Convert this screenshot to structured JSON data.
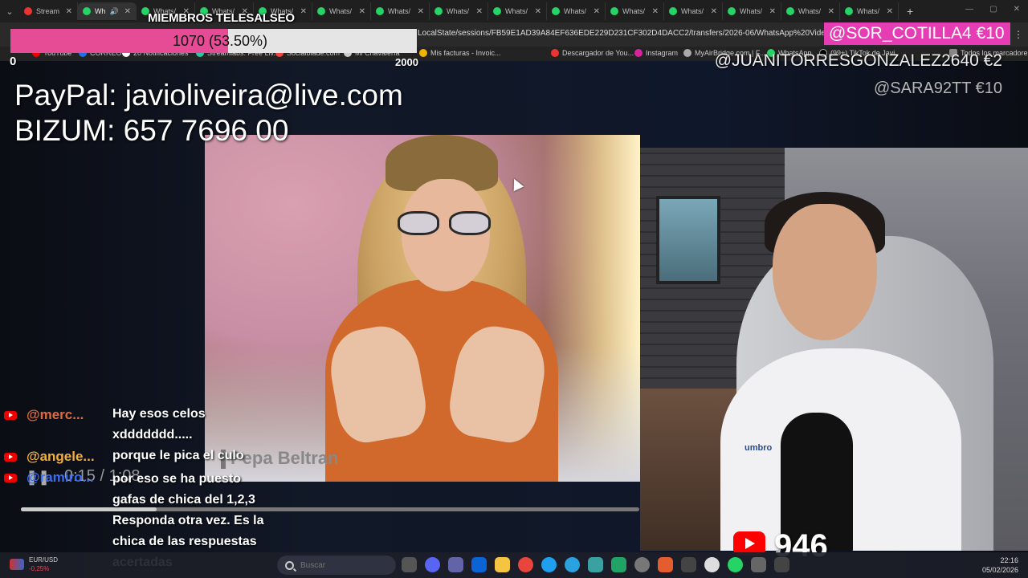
{
  "browser": {
    "tabs": [
      {
        "label": "Stream"
      },
      {
        "label": "Wh"
      },
      {
        "label": "Whats/"
      },
      {
        "label": "Whats/"
      },
      {
        "label": "Whats/"
      },
      {
        "label": "Whats/"
      },
      {
        "label": "Whats/"
      },
      {
        "label": "Whats/"
      },
      {
        "label": "Whats/"
      },
      {
        "label": "Whats/"
      },
      {
        "label": "Whats/"
      },
      {
        "label": "Whats/"
      },
      {
        "label": "Whats/"
      },
      {
        "label": "Whats/"
      },
      {
        "label": "Whats/"
      }
    ],
    "url": "LocalState/sessions/FB59E1AD39A84EF636EDE229D231CF302D4DACC2/transfers/2026-06/WhatsApp%20Video%2020...",
    "bookmarks": [
      {
        "label": "YouTube"
      },
      {
        "label": "CORREO"
      },
      {
        "label": "20 Notificaciones"
      },
      {
        "label": "Streamlabs: Free Liv..."
      },
      {
        "label": "Socialblade.com"
      },
      {
        "label": "Mi Chavalería"
      },
      {
        "label": "Mis facturas - Invoic..."
      },
      {
        "label": "Descargador de You..."
      },
      {
        "label": "Instagram"
      },
      {
        "label": "MyAirBridge.com | F..."
      },
      {
        "label": "WhatsApp"
      },
      {
        "label": "(99+) TikTok de Javi"
      },
      {
        "label": "Todos los marcadores"
      }
    ]
  },
  "overlay": {
    "members_title": "MIEMBROS TELESALSEO",
    "progress_text": "1070 (53.50%)",
    "progress_fraction": 0.535,
    "progress_min": "0",
    "progress_max": "2000",
    "paypal": "PayPal: javioliveira@live.com",
    "bizum": "BIZUM: 657 7696 00",
    "donations": [
      {
        "text": "@SOR_COTILLA4  €10"
      },
      {
        "text": "@JUANITORRESGONZALEZ2640  €2"
      },
      {
        "text": "@SARA92TT  €10"
      }
    ],
    "viewers": "946"
  },
  "guest_video": {
    "name_plate": "Pepa Beltran",
    "time": "0:15 / 1:08",
    "played_fraction": 0.22
  },
  "host_cam": {
    "shirt_brand": "umbro"
  },
  "chat": [
    {
      "user": "@merc...",
      "msg": "Hay esos celos xddddddd....."
    },
    {
      "user": "@angele...",
      "msg": "porque le pica el culo"
    },
    {
      "user": "@ramiro...",
      "msg": "por eso se ha puesto gafas de chica del 1,2,3 Responda otra vez. Es la chica de las respuestas acertadas"
    }
  ],
  "taskbar": {
    "ticker_pair": "EUR/USD",
    "ticker_change": "-0,25%",
    "search_placeholder": "Buscar",
    "time": "22:16",
    "date": "05/02/2026"
  },
  "colors": {
    "progress_fill": "#e64c95",
    "donation_highlight": "#e73db4",
    "chat_user": "#f2b03a",
    "youtube_red": "#ff0000"
  }
}
